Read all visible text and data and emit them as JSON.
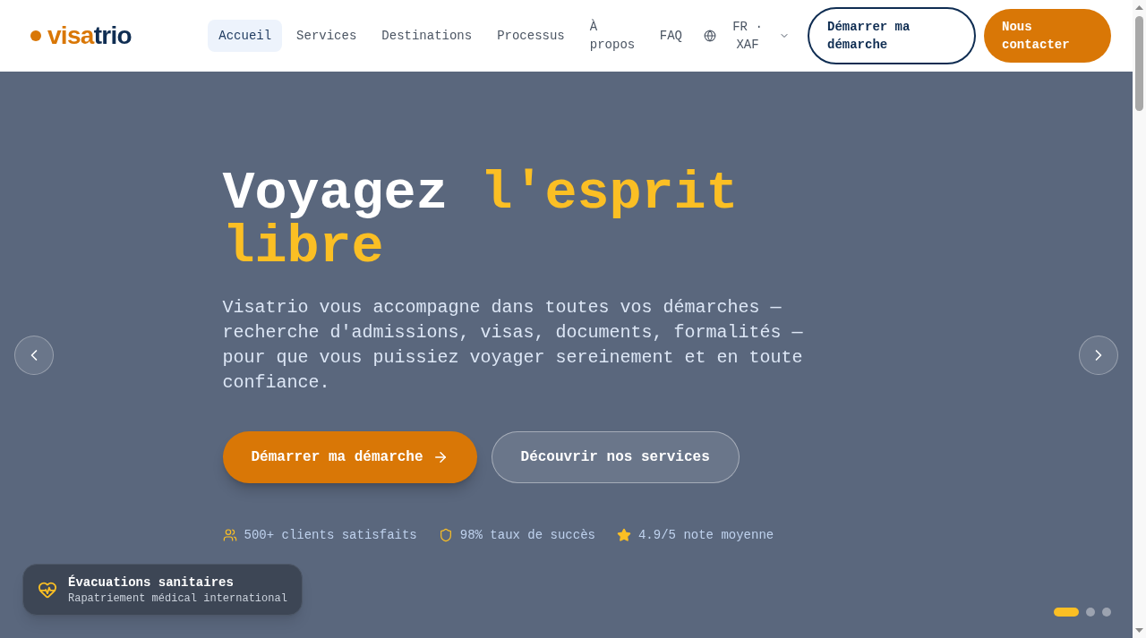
{
  "header": {
    "logo": {
      "part_1": "visa",
      "part_2": "trio"
    },
    "nav": [
      {
        "label": "Accueil",
        "selected": true
      },
      {
        "label": "Services",
        "selected": false
      },
      {
        "label": "Destinations",
        "selected": false
      },
      {
        "label": "Processus",
        "selected": false
      },
      {
        "label": "À propos",
        "selected": false
      },
      {
        "label": "FAQ",
        "selected": false
      }
    ],
    "language": "FR · XAF",
    "buttons": [
      {
        "label": "Démarrer ma démarche",
        "kind": "outline"
      },
      {
        "label": "Nous contacter",
        "kind": "filled"
      }
    ]
  },
  "hero": {
    "title": {
      "plain": "Voyagez",
      "highlight": "l'esprit libre"
    },
    "text": "Visatrio vous accompagne dans toutes vos démarches — recherche d'admissions, visas, documents, formalités — pour que vous puissiez voyager sereinement et en toute confiance.",
    "buttons": [
      {
        "label": "Démarrer ma démarche",
        "kind": "primary"
      },
      {
        "label": "Découvrir nos services",
        "kind": "secondary"
      }
    ],
    "stats": [
      {
        "kind": "users",
        "text": "500+ clients satisfaits"
      },
      {
        "kind": "shield",
        "text": "98% taux de succès"
      },
      {
        "kind": "star",
        "text": "4.9/5 note moyenne"
      }
    ],
    "feature_card": {
      "title": "Évacuations sanitaires",
      "subtitle": "Rapatriement médical international"
    },
    "slides": [
      {
        "selected": true
      },
      {
        "selected": false
      },
      {
        "selected": false
      }
    ]
  }
}
